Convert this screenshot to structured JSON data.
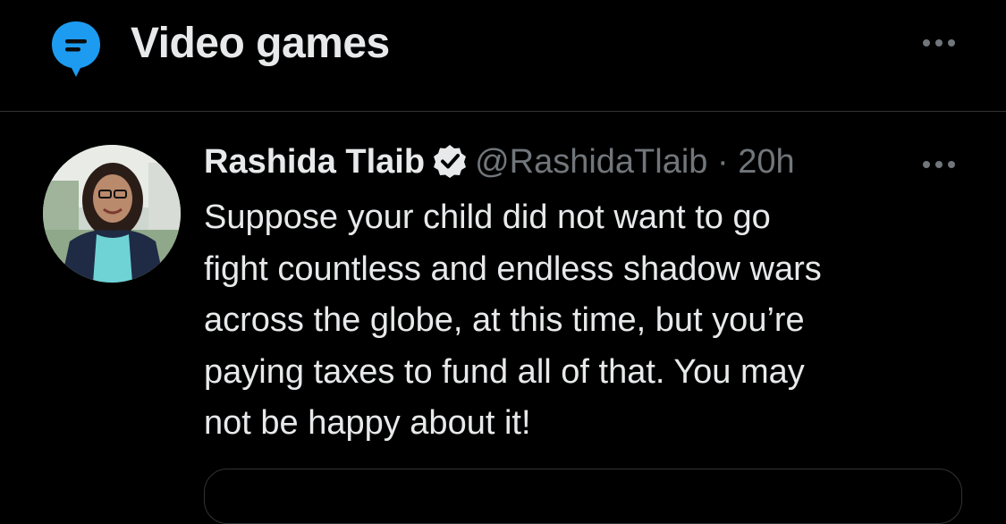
{
  "header": {
    "title": "Video games",
    "topic_icon": "topic-bubble-icon",
    "more_icon": "more-horizontal-icon",
    "accent_color": "#1d9bf0"
  },
  "tweet": {
    "author_name": "Rashida Tlaib",
    "verified_icon": "verified-badge-icon",
    "handle": "@RashidaTlaib",
    "separator": "·",
    "timestamp": "20h",
    "more_icon": "more-horizontal-icon",
    "body_lines": [
      "Suppose your child did not want to go",
      "fight countless and endless shadow wars",
      "across the globe, at this time, but you’re",
      "paying taxes to fund all of that. You may",
      "not be happy about it!"
    ]
  },
  "colors": {
    "background": "#000000",
    "primary_text": "#e7e9ea",
    "secondary_text": "#71767b",
    "divider": "#2f3336"
  }
}
